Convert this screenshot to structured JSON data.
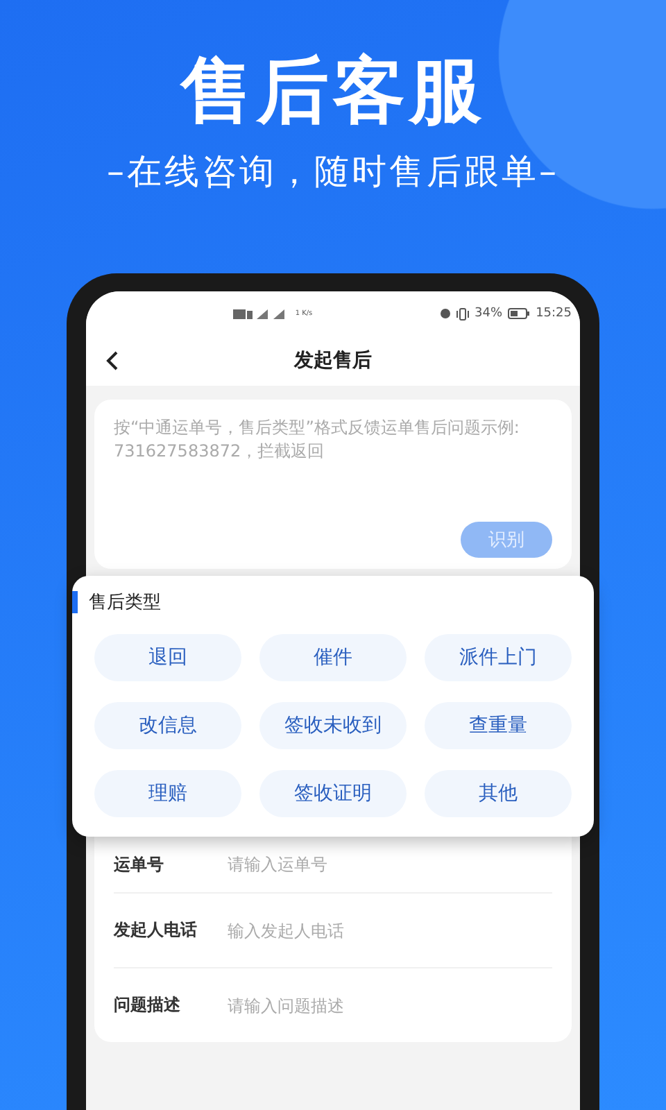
{
  "headline": "售后客服",
  "subtitle": "–在线咨询，随时售后跟单–",
  "status_bar": {
    "speed": "1 K/s",
    "battery": "34%",
    "time": "15:25"
  },
  "nav": {
    "title": "发起售后"
  },
  "recognize": {
    "placeholder": "按“中通运单号，售后类型”格式反馈运单售后问题示例:\n731627583872，拦截返回",
    "button": {
      "label": "识别",
      "disabled": true
    }
  },
  "type_popup": {
    "title": "售后类型",
    "options": [
      {
        "label": "退回"
      },
      {
        "label": "催件"
      },
      {
        "label": "派件上门"
      },
      {
        "label": "改信息"
      },
      {
        "label": "签收未收到"
      },
      {
        "label": "查重量"
      },
      {
        "label": "理赔"
      },
      {
        "label": "签收证明"
      },
      {
        "label": "其他"
      }
    ]
  },
  "form": [
    {
      "label": "运单号",
      "placeholder": "请输入运单号"
    },
    {
      "label": "发起人电话",
      "placeholder": "输入发起人电话"
    },
    {
      "label": "问题描述",
      "placeholder": "请输入问题描述"
    }
  ]
}
